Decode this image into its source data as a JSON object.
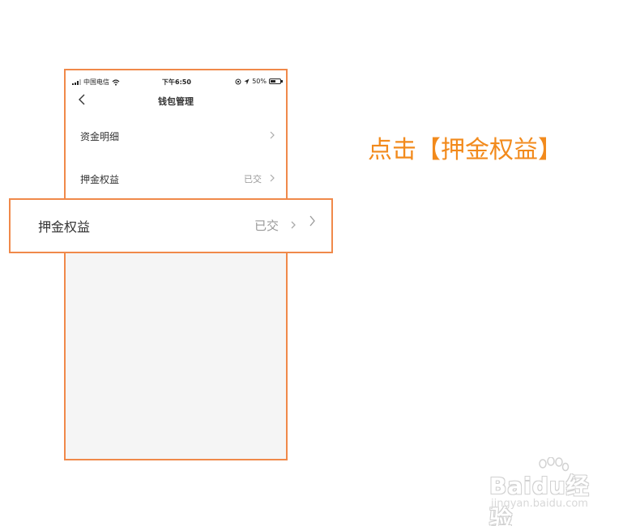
{
  "statusbar": {
    "carrier": "中国电信",
    "time": "下午6:50",
    "battery": "50%"
  },
  "navbar": {
    "title": "钱包管理"
  },
  "rows": [
    {
      "label": "资金明细",
      "value": ""
    },
    {
      "label": "押金权益",
      "value": "已交"
    }
  ],
  "callout": {
    "label": "押金权益",
    "value": "已交"
  },
  "instruction": "点击【押金权益】",
  "watermark": {
    "brand": "Baidu经验",
    "url": "jingyan.baidu.com"
  },
  "colors": {
    "accent": "#f0894a",
    "instruction": "#f28a1c"
  }
}
